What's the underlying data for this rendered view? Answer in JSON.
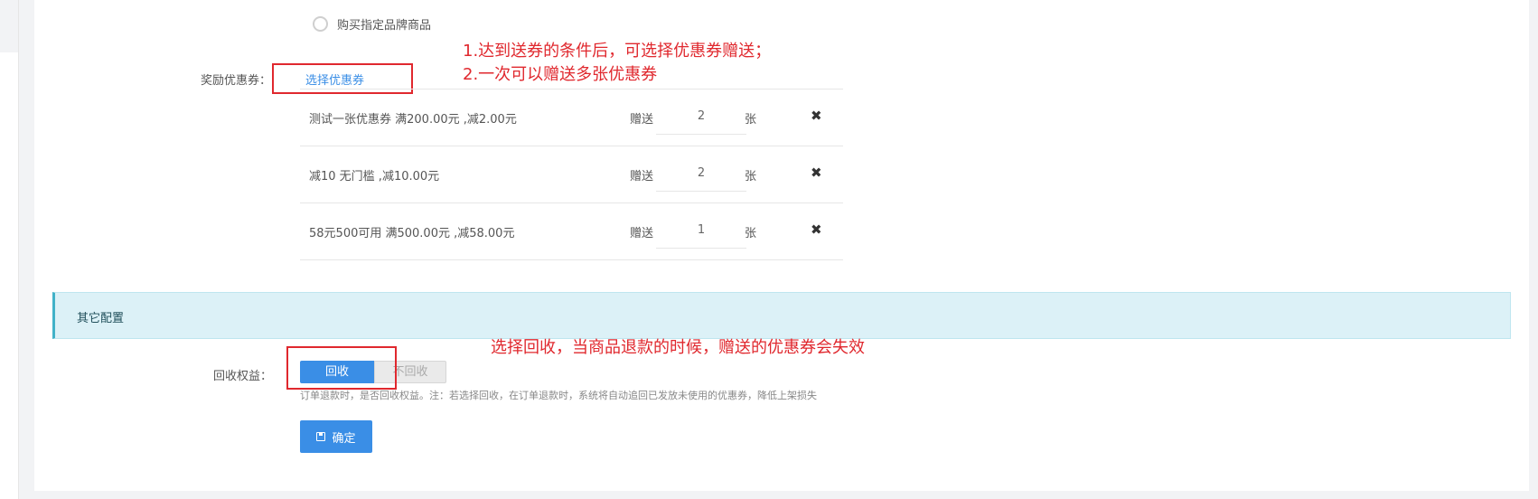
{
  "form": {
    "brand_option_label": "购买指定品牌商品",
    "reward_label": "奖励优惠券：",
    "select_coupon_link": "选择优惠券",
    "coupons": [
      {
        "name": "测试一张优惠券 满200.00元 ,减2.00元",
        "give_label": "赠送",
        "quantity": "2",
        "unit": "张"
      },
      {
        "name": "减10 无门槛 ,减10.00元",
        "give_label": "赠送",
        "quantity": "2",
        "unit": "张"
      },
      {
        "name": "58元500可用 满500.00元 ,减58.00元",
        "give_label": "赠送",
        "quantity": "1",
        "unit": "张"
      }
    ],
    "delete_glyph": "✖"
  },
  "section": {
    "title": "其它配置"
  },
  "reclaim": {
    "label": "回收权益：",
    "on_label": "回收",
    "off_label": "不回收",
    "selected": "回收",
    "help": "订单退款时，是否回收权益。注：若选择回收，在订单退款时，系统将自动追回已发放未使用的优惠券，降低上架损失"
  },
  "confirm_button": "确定",
  "annotations": {
    "note_1": "1.达到送券的条件后，可选择优惠券赠送；",
    "note_2": "2.一次可以赠送多张优惠券",
    "note_3": "选择回收，当商品退款的时候，赠送的优惠券会失效",
    "color": "#e0282e"
  },
  "colors": {
    "accent": "#3a8ee6",
    "section_bg": "#dcf1f7",
    "section_border": "#41b2c8"
  }
}
